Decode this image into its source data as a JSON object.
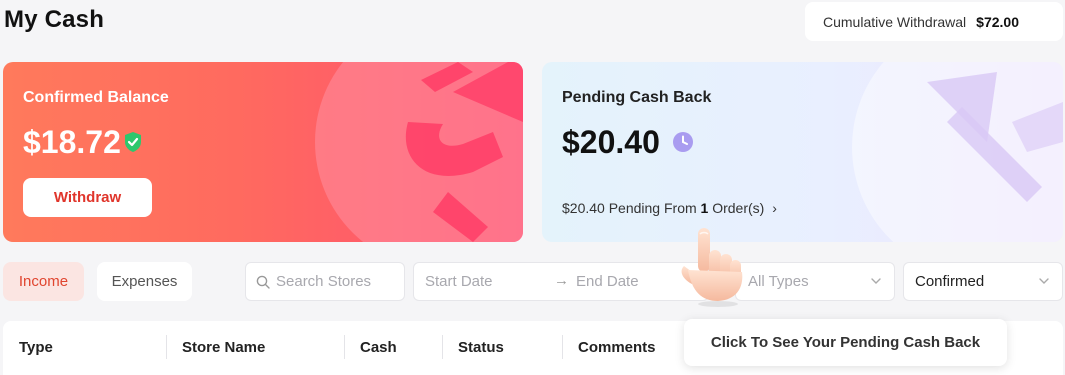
{
  "page": {
    "title": "My Cash"
  },
  "cumulative": {
    "label": "Cumulative Withdrawal",
    "amount": "$72.00"
  },
  "confirmed_card": {
    "label": "Confirmed Balance",
    "amount": "$18.72",
    "withdraw_label": "Withdraw",
    "icon": "shield-check-icon",
    "gradient_start": "#ff7a5c",
    "gradient_end": "#ff4f72"
  },
  "pending_card": {
    "label": "Pending Cash Back",
    "amount": "$20.40",
    "icon": "clock-icon",
    "link_prefix": "$20.40 Pending From ",
    "order_count": "1",
    "link_suffix": " Order(s)",
    "link_arrow": "›"
  },
  "tabs": [
    {
      "label": "Income",
      "active": true
    },
    {
      "label": "Expenses",
      "active": false
    }
  ],
  "filters": {
    "search_placeholder": "Search Stores",
    "start_date_placeholder": "Start Date",
    "date_arrow": "→",
    "end_date_placeholder": "End Date",
    "type_select": "All Types",
    "status_select": "Confirmed"
  },
  "table": {
    "columns": [
      "Type",
      "Store Name",
      "Cash",
      "Status",
      "Comments"
    ]
  },
  "tooltip": {
    "text": "Click To See Your Pending Cash Back"
  },
  "colors": {
    "accent": "#e0352b",
    "income_tab_bg": "#fbe5e2",
    "clock_purple": "#a99cf0",
    "shield_green": "#2dc76d"
  }
}
